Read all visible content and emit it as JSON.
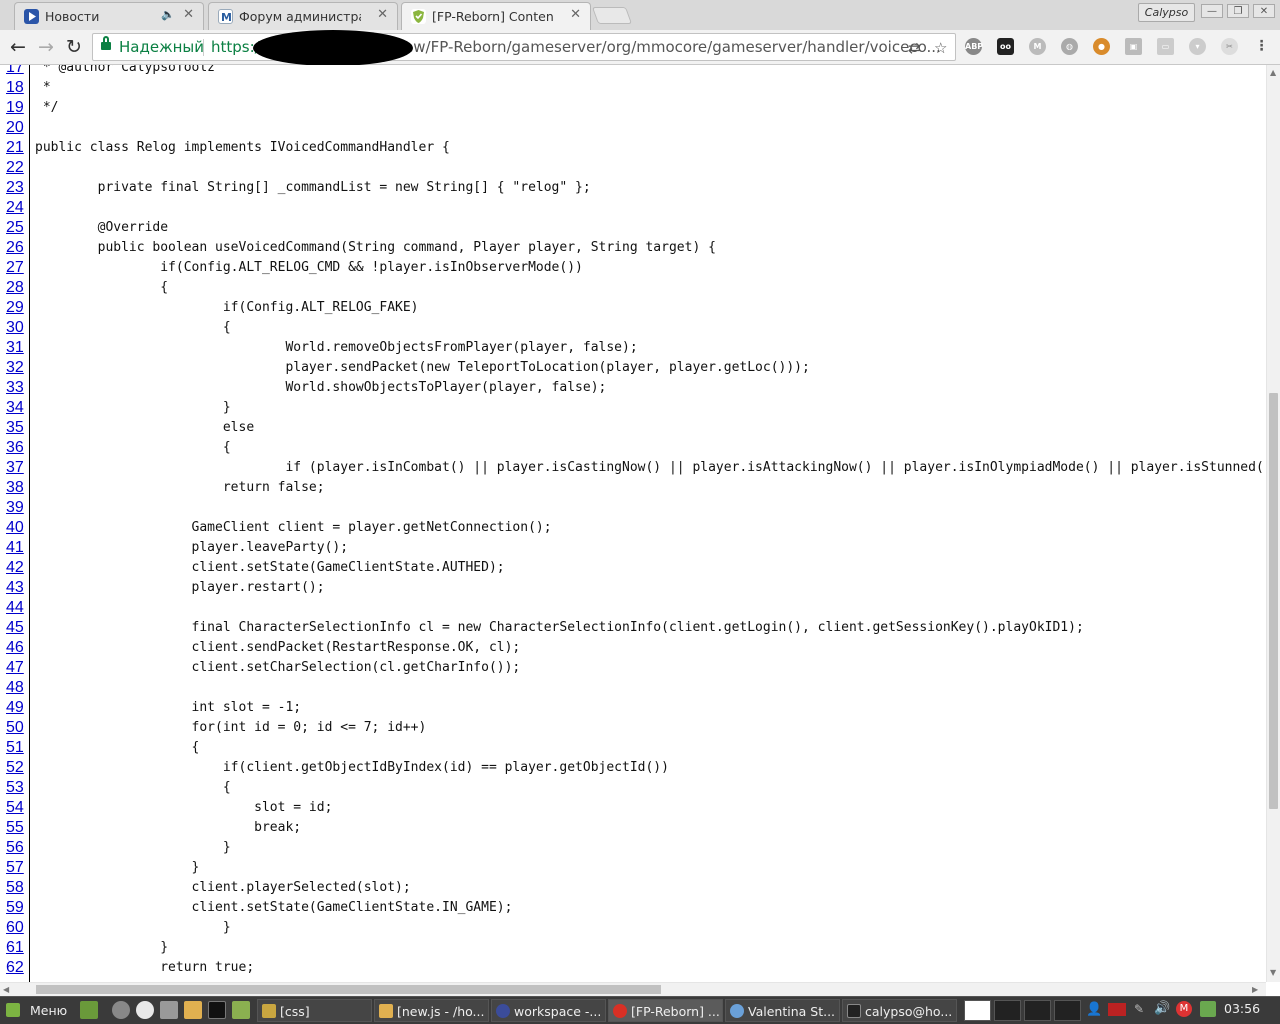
{
  "tabs": [
    {
      "title": "Новости"
    },
    {
      "title": "Форум администратора"
    },
    {
      "title": "[FP-Reborn] Contents of"
    }
  ],
  "window": {
    "profile": "Calypso"
  },
  "omnibox": {
    "secure_label": "Надежный",
    "scheme": "https://",
    "url_rest": "/ew/FP-Reborn/gameserver/org/mmocore/gameserver/handler/voiceco..."
  },
  "extensions": {
    "abp": "ABP"
  },
  "code": {
    "lines": [
      {
        "n": "17",
        "text": " * @author CalypsoToolz"
      },
      {
        "n": "18",
        "text": " *"
      },
      {
        "n": "19",
        "text": " */"
      },
      {
        "n": "20",
        "text": ""
      },
      {
        "n": "21",
        "text": "public class Relog implements IVoicedCommandHandler {"
      },
      {
        "n": "22",
        "text": ""
      },
      {
        "n": "23",
        "text": "        private final String[] _commandList = new String[] { \"relog\" };"
      },
      {
        "n": "24",
        "text": ""
      },
      {
        "n": "25",
        "text": "        @Override"
      },
      {
        "n": "26",
        "text": "        public boolean useVoicedCommand(String command, Player player, String target) {"
      },
      {
        "n": "27",
        "text": "                if(Config.ALT_RELOG_CMD && !player.isInObserverMode())"
      },
      {
        "n": "28",
        "text": "                {"
      },
      {
        "n": "29",
        "text": "                        if(Config.ALT_RELOG_FAKE)"
      },
      {
        "n": "30",
        "text": "                        {"
      },
      {
        "n": "31",
        "text": "                                World.removeObjectsFromPlayer(player, false);"
      },
      {
        "n": "32",
        "text": "                                player.sendPacket(new TeleportToLocation(player, player.getLoc()));"
      },
      {
        "n": "33",
        "text": "                                World.showObjectsToPlayer(player, false);"
      },
      {
        "n": "34",
        "text": "                        }"
      },
      {
        "n": "35",
        "text": "                        else"
      },
      {
        "n": "36",
        "text": "                        {"
      },
      {
        "n": "37",
        "text": "                                if (player.isInCombat() || player.isCastingNow() || player.isAttackingNow() || player.isInOlympiadMode() || player.isStunned("
      },
      {
        "n": "38",
        "text": "                        return false;"
      },
      {
        "n": "39",
        "text": ""
      },
      {
        "n": "40",
        "text": "                    GameClient client = player.getNetConnection();"
      },
      {
        "n": "41",
        "text": "                    player.leaveParty();"
      },
      {
        "n": "42",
        "text": "                    client.setState(GameClientState.AUTHED);"
      },
      {
        "n": "43",
        "text": "                    player.restart();"
      },
      {
        "n": "44",
        "text": ""
      },
      {
        "n": "45",
        "text": "                    final CharacterSelectionInfo cl = new CharacterSelectionInfo(client.getLogin(), client.getSessionKey().playOkID1);"
      },
      {
        "n": "46",
        "text": "                    client.sendPacket(RestartResponse.OK, cl);"
      },
      {
        "n": "47",
        "text": "                    client.setCharSelection(cl.getCharInfo());"
      },
      {
        "n": "48",
        "text": ""
      },
      {
        "n": "49",
        "text": "                    int slot = -1;"
      },
      {
        "n": "50",
        "text": "                    for(int id = 0; id <= 7; id++)"
      },
      {
        "n": "51",
        "text": "                    {"
      },
      {
        "n": "52",
        "text": "                        if(client.getObjectIdByIndex(id) == player.getObjectId())"
      },
      {
        "n": "53",
        "text": "                        {"
      },
      {
        "n": "54",
        "text": "                            slot = id;"
      },
      {
        "n": "55",
        "text": "                            break;"
      },
      {
        "n": "56",
        "text": "                        }"
      },
      {
        "n": "57",
        "text": "                    }"
      },
      {
        "n": "58",
        "text": "                    client.playerSelected(slot);"
      },
      {
        "n": "59",
        "text": "                    client.setState(GameClientState.IN_GAME);"
      },
      {
        "n": "60",
        "text": "                        }"
      },
      {
        "n": "61",
        "text": "                }"
      },
      {
        "n": "62",
        "text": "                return true;"
      }
    ]
  },
  "taskbar": {
    "menu_label": "Меню",
    "windows": [
      {
        "label": "[css]",
        "icon_color": "#c9a640"
      },
      {
        "label": "[new.js - /ho...",
        "icon_color": "#e0b050"
      },
      {
        "label": "workspace -...",
        "icon_color": "#3b4c9a"
      },
      {
        "label": "[FP-Reborn] ...",
        "icon_color": "#d93025"
      },
      {
        "label": "Valentina St...",
        "icon_color": "#6aa0d8"
      },
      {
        "label": "calypso@ho...",
        "icon_color": "#222222"
      }
    ],
    "clock": "03:56"
  }
}
